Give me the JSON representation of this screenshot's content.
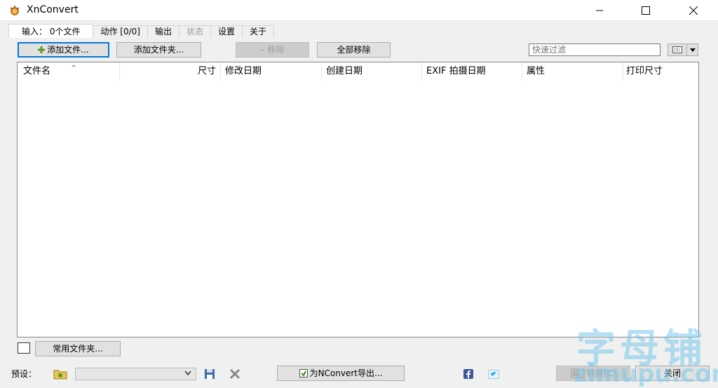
{
  "window": {
    "title": "XnConvert",
    "controls": {
      "minimize": "minimize",
      "maximize": "maximize",
      "close": "close"
    }
  },
  "tabs": [
    {
      "label": "输入：  0个文件",
      "active": true
    },
    {
      "label": "动作 [0/0]"
    },
    {
      "label": "输出"
    },
    {
      "label": "状态",
      "disabled": true
    },
    {
      "label": "设置"
    },
    {
      "label": "关于"
    }
  ],
  "toolbar": {
    "add_files": "添加文件...",
    "add_folder": "添加文件夹...",
    "remove": "– 移除",
    "remove_all": "全部移除",
    "filter_placeholder": "快速过滤"
  },
  "table": {
    "columns": [
      "文件名",
      "尺寸",
      "修改日期",
      "创建日期",
      "EXIF 拍摄日期",
      "属性",
      "打印尺寸"
    ],
    "rows": []
  },
  "footer": {
    "common_folders": "常用文件夹...",
    "preset_label": "预设：",
    "export_label": "为NConvert导出...",
    "convert_label": "转换(C)",
    "close_label": "关闭"
  },
  "watermark": {
    "cn": "字母铺",
    "en": "zimupu.com"
  },
  "colors": {
    "accent": "#0078d7",
    "facebook": "#3b5998",
    "twitter": "#1da1f2",
    "folder": "#e8c44c"
  },
  "icons": [
    "app-icon",
    "add-icon",
    "view-mode-icon",
    "folder-icon",
    "save-icon",
    "delete-icon",
    "export-icon",
    "facebook-icon",
    "twitter-icon",
    "convert-icon"
  ]
}
